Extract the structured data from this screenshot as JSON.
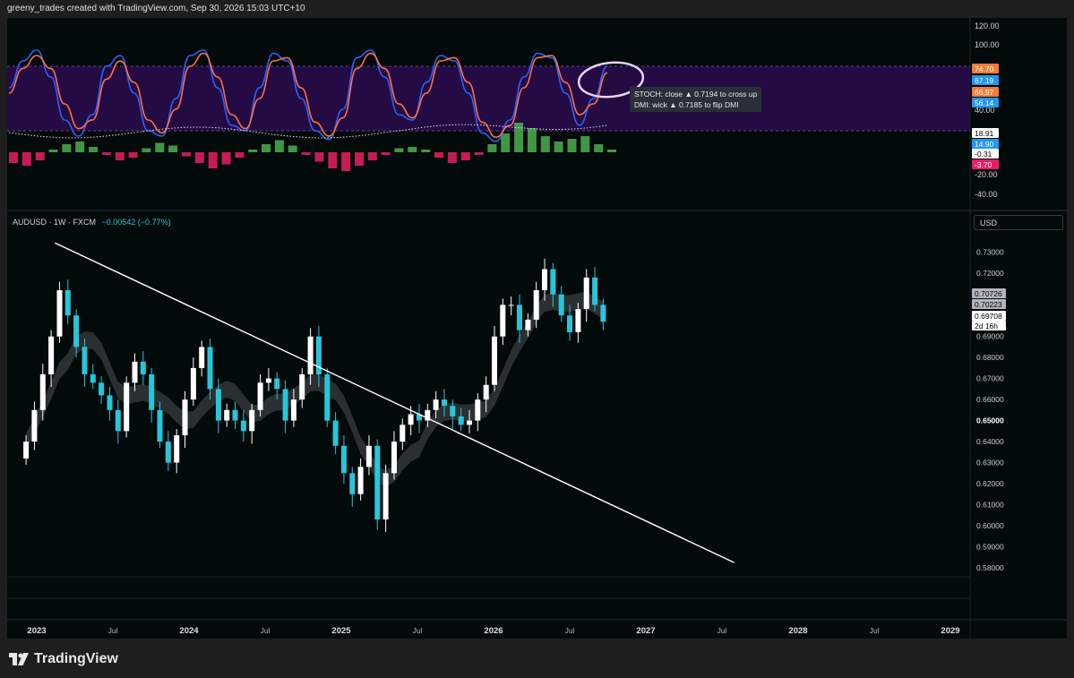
{
  "header": {
    "title": "greeny_trades created with TradingView.com, Sep 30, 2026 15:03 UTC+10"
  },
  "symbol": {
    "name": "AUDUSD · 1W · FXCM",
    "change": "−0.00542 (−0.77%)"
  },
  "currency_button": "USD",
  "tooltip": {
    "line1": "STOCH: close ▲ 0.7194 to cross up",
    "line2": "DMI: wick ▲ 0.7185 to flip DMI"
  },
  "footer": {
    "brand": "TradingView"
  },
  "colors": {
    "bg": "#030a0a",
    "up": "#ffffff",
    "down": "#26c6da",
    "band": "#2b0c4f",
    "stoch_k": "#2962ff",
    "stoch_d": "#ff7043",
    "hist_up": "#4caf50",
    "hist_down": "#e91e63"
  },
  "chart_data": [
    {
      "type": "line",
      "title": "Oscillator panel (Stochastic / DMI / histogram)",
      "y_ticks": [
        "120.00",
        "100.00",
        "40.00",
        "-20.00",
        "-40.00"
      ],
      "levels": [
        80,
        20
      ],
      "labels": [
        {
          "text": "74.70",
          "color": "#f57c38"
        },
        {
          "text": "67.19",
          "color": "#2196f3"
        },
        {
          "text": "66.97",
          "color": "#f57c38"
        },
        {
          "text": "56.14",
          "color": "#2196f3"
        },
        {
          "text": "18.91",
          "color": "#ffffff"
        },
        {
          "text": "14.90",
          "color": "#2196f3"
        },
        {
          "text": "-0.31",
          "color": "#ffffff"
        },
        {
          "text": "-3.70",
          "color": "#e91e63"
        }
      ],
      "series": [
        {
          "name": "%K",
          "values": [
            60,
            85,
            95,
            70,
            30,
            15,
            35,
            80,
            90,
            55,
            20,
            15,
            50,
            90,
            95,
            60,
            25,
            20,
            60,
            92,
            85,
            50,
            20,
            12,
            40,
            88,
            95,
            70,
            35,
            30,
            65,
            90,
            85,
            55,
            18,
            10,
            30,
            70,
            92,
            88,
            55,
            25,
            50,
            80
          ]
        },
        {
          "name": "%D",
          "values": [
            55,
            78,
            90,
            78,
            45,
            22,
            30,
            68,
            85,
            65,
            30,
            18,
            40,
            80,
            92,
            70,
            35,
            22,
            50,
            85,
            88,
            60,
            28,
            15,
            32,
            78,
            92,
            78,
            45,
            32,
            55,
            85,
            88,
            65,
            28,
            14,
            25,
            60,
            88,
            90,
            65,
            35,
            45,
            74
          ]
        }
      ],
      "histogram": [
        -8,
        -10,
        -6,
        2,
        6,
        8,
        4,
        -2,
        -6,
        -4,
        3,
        7,
        5,
        -3,
        -8,
        -12,
        -9,
        -4,
        2,
        6,
        9,
        5,
        -2,
        -7,
        -12,
        -14,
        -10,
        -6,
        -2,
        3,
        4,
        2,
        -4,
        -8,
        -6,
        -2,
        6,
        14,
        22,
        18,
        12,
        8,
        10,
        12,
        6,
        2
      ]
    },
    {
      "type": "candlestick",
      "title": "AUDUSD · 1W · FXCM",
      "x_tick_labels": [
        "2023",
        "Jul",
        "2024",
        "Jul",
        "2025",
        "Jul",
        "2026",
        "Jul",
        "2027",
        "Jul",
        "2028",
        "Jul",
        "2029"
      ],
      "x_ticks": [
        2023.0,
        2023.5,
        2024.0,
        2024.5,
        2025.0,
        2025.5,
        2026.0,
        2026.5,
        2027.0,
        2027.5,
        2028.0,
        2028.5,
        2029.0
      ],
      "y_ticks": [
        "0.73000",
        "0.72000",
        "0.71000",
        "0.69000",
        "0.68000",
        "0.67000",
        "0.66000",
        "0.65000",
        "0.64000",
        "0.63000",
        "0.62000",
        "0.61000",
        "0.60000",
        "0.59000",
        "0.58000"
      ],
      "ylim": [
        0.577,
        0.735
      ],
      "price_labels": [
        {
          "text": "0.70726"
        },
        {
          "text": "0.70223"
        },
        {
          "text": "0.69708"
        },
        {
          "text": "2d 16h"
        }
      ],
      "trendline": {
        "x": [
          2023.12,
          2027.58
        ],
        "y": [
          0.7345,
          0.5825
        ]
      },
      "closes": [
        0.64,
        0.655,
        0.672,
        0.69,
        0.712,
        0.7,
        0.685,
        0.672,
        0.668,
        0.662,
        0.655,
        0.645,
        0.668,
        0.678,
        0.672,
        0.655,
        0.64,
        0.63,
        0.643,
        0.66,
        0.675,
        0.685,
        0.665,
        0.65,
        0.655,
        0.65,
        0.645,
        0.655,
        0.668,
        0.67,
        0.665,
        0.65,
        0.66,
        0.672,
        0.69,
        0.672,
        0.65,
        0.638,
        0.625,
        0.615,
        0.628,
        0.638,
        0.603,
        0.625,
        0.64,
        0.648,
        0.653,
        0.65,
        0.655,
        0.66,
        0.657,
        0.652,
        0.648,
        0.65,
        0.66,
        0.667,
        0.69,
        0.705,
        0.705,
        0.693,
        0.698,
        0.712,
        0.722,
        0.71,
        0.7,
        0.692,
        0.703,
        0.718,
        0.705,
        0.697
      ]
    }
  ]
}
